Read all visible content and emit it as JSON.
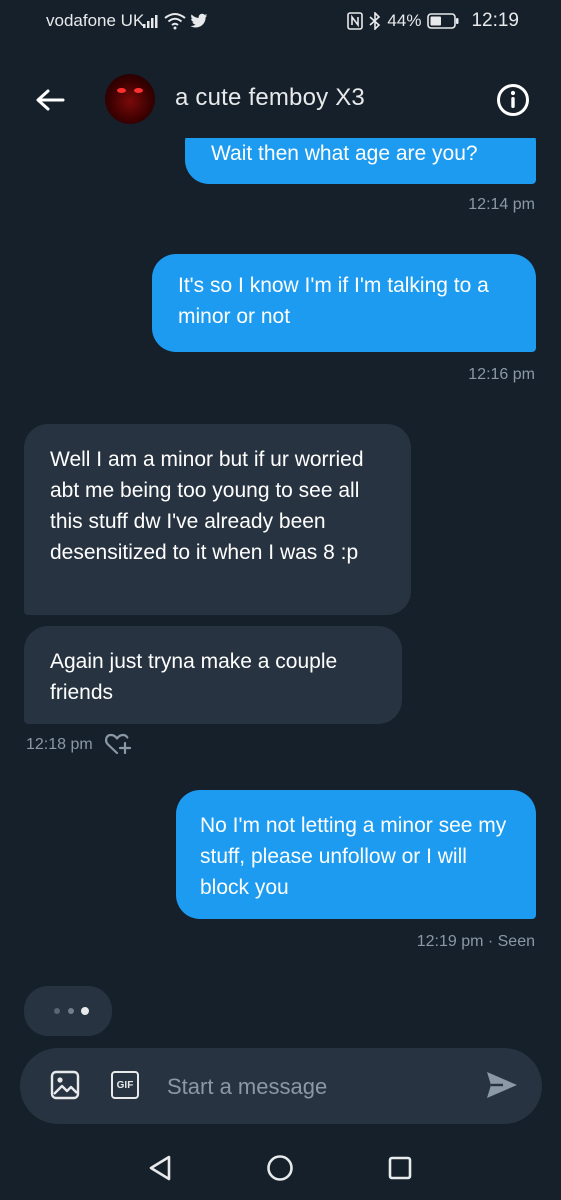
{
  "status_bar": {
    "carrier": "vodafone UK",
    "battery": "44%",
    "time": "12:19"
  },
  "header": {
    "contact_name": "a cute femboy X3"
  },
  "messages": [
    {
      "direction": "outgoing",
      "text": "Wait then what age are you?"
    },
    {
      "direction": "outgoing",
      "text": "It's so I know I'm if I'm talking to a minor or not"
    },
    {
      "direction": "incoming",
      "text": "Well I am a minor but if ur worried abt me being too young to see all this stuff dw I've already been desensitized to it when I was 8 :p"
    },
    {
      "direction": "incoming",
      "text": "Again just tryna make a couple friends"
    },
    {
      "direction": "outgoing",
      "text": "No I'm not letting a minor see my stuff, please unfollow or I will block you"
    }
  ],
  "timestamps": {
    "t1": "12:14 pm",
    "t2": "12:16 pm",
    "t3": "12:18 pm",
    "t4": "12:19 pm · Seen"
  },
  "composer": {
    "placeholder": "Start a message",
    "gif_label": "GIF"
  },
  "colors": {
    "background": "#15202b",
    "outgoing_bubble": "#1d9bf0",
    "incoming_bubble": "#273340",
    "muted_text": "#8b98a5"
  },
  "icons": [
    "back-arrow-icon",
    "info-icon",
    "like-plus-icon",
    "image-icon",
    "gif-icon",
    "send-icon",
    "nav-back-icon",
    "nav-home-icon",
    "nav-recents-icon"
  ]
}
